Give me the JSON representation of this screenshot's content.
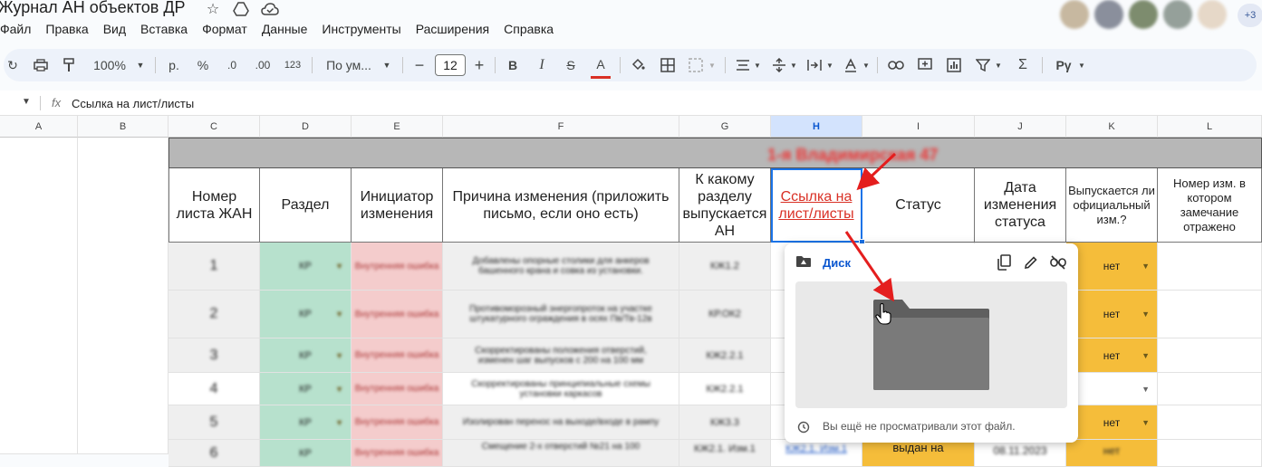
{
  "window": {
    "doc_title": "Журнал АН объектов ДР",
    "collaborators_more": "+3"
  },
  "menu": [
    "Файл",
    "Правка",
    "Вид",
    "Вставка",
    "Формат",
    "Данные",
    "Инструменты",
    "Расширения",
    "Справка"
  ],
  "toolbar": {
    "zoom": "100%",
    "currency": "р.",
    "percent": "%",
    "dec_decrease": ".0",
    "dec_increase": ".00",
    "number_format": "123",
    "font": "По ум...",
    "font_size": "12",
    "bold": "B",
    "italic": "I",
    "strike": "S",
    "text_color": "A",
    "sigma": "Σ",
    "input_tools": "Рγ"
  },
  "formula_bar": {
    "fx": "fx",
    "content": "Ссылка на лист/листы"
  },
  "columns": [
    "A",
    "B",
    "C",
    "D",
    "E",
    "F",
    "G",
    "H",
    "I",
    "J",
    "K",
    "L"
  ],
  "table": {
    "banner": "1-я Владимирская 47",
    "headers": {
      "c": "Номер листа ЖАН",
      "d": "Раздел",
      "e": "Инициатор изменения",
      "f": "Причина изменения (приложить письмо, если оно есть)",
      "g": "К какому разделу выпускается АН",
      "h": "Ссылка на лист/листы",
      "i": "Статус",
      "j": "Дата изменения статуса",
      "k": "Выпускается ли официальный изм.?",
      "l": "Номер изм. в котором замечание отражено"
    },
    "rows": [
      {
        "num": "1",
        "section": "КР",
        "initiator": "Внутренняя ошибка",
        "reason": "Добавлены опорные столики для анкеров башенного крана и совка из установки.",
        "target": "КЖ1.2",
        "official": "нет"
      },
      {
        "num": "2",
        "section": "КР",
        "initiator": "Внутренняя ошибка",
        "reason": "Противоморозный энергопроток на участке штукатурного ограждения в осях Пв/Тв-12в",
        "target": "КР.ОК2",
        "official": "нет"
      },
      {
        "num": "3",
        "section": "КР",
        "initiator": "Внутренняя ошибка",
        "reason": "Скорректированы положения отверстий, изменен шаг выпусков с 200 на 100 мм",
        "target": "КЖ2.2.1",
        "official": "нет"
      },
      {
        "num": "4",
        "section": "КР",
        "initiator": "Внутренняя ошибка",
        "reason": "Скорректированы принципиальные схемы установки каркасов",
        "target": "КЖ2.2.1",
        "official": ""
      },
      {
        "num": "5",
        "section": "КР",
        "initiator": "Внутренняя ошибка",
        "reason": "Изолирован перенос на выходе/входе в рампу",
        "target": "КЖ3.3",
        "official": "нет"
      },
      {
        "num": "6",
        "section": "КР",
        "initiator": "Внутренняя ошибка",
        "reason": "Смещение 2-х отверстий №21 на 100",
        "target": "КЖ2.1. Изм.1",
        "link": "КЖ2.1. Изм.1",
        "status": "выдан на",
        "date": "08.11.2023",
        "official": "нет"
      }
    ]
  },
  "popup": {
    "title": "Диск",
    "footer": "Вы ещё не просматривали этот файл."
  },
  "colors": {
    "accent": "#1a73e8",
    "link_red": "#d93025",
    "yellow": "#f5bd3a",
    "green_chip": "#b7e1cd",
    "red_chip": "#f4cccc"
  }
}
